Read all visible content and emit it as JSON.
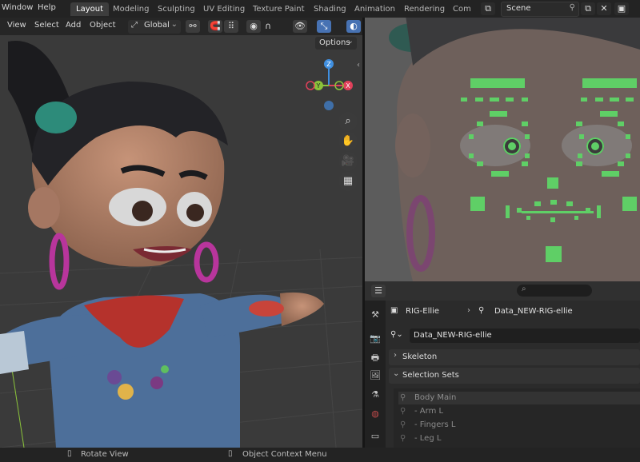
{
  "menubar": {
    "items": [
      "Window",
      "Help"
    ],
    "workspaces": [
      "Layout",
      "Modeling",
      "Sculpting",
      "UV Editing",
      "Texture Paint",
      "Shading",
      "Animation",
      "Rendering",
      "Comp"
    ],
    "active_workspace": "Layout",
    "scene_name": "Scene"
  },
  "viewport": {
    "menus": [
      "View",
      "Select",
      "Add",
      "Object"
    ],
    "transform_orientation": "Global",
    "options_label": "Options",
    "gizmo_axes": {
      "x": "X",
      "y": "Y",
      "z": "Z"
    }
  },
  "properties": {
    "breadcrumb_object": "RIG-Ellie",
    "breadcrumb_data": "Data_NEW-RIG-ellie",
    "data_field": "Data_NEW-RIG-ellie",
    "panels": {
      "skeleton": "Skeleton",
      "selection_sets": "Selection Sets"
    },
    "selection_sets": [
      "Body Main",
      "- Arm L",
      "- Fingers L",
      "- Leg L"
    ]
  },
  "statusbar": {
    "rotate": "Rotate View",
    "context_menu": "Object Context Menu"
  },
  "colors": {
    "accent": "#4772b3",
    "bone_widget": "#5fcf66",
    "axis_x": "#e0405a",
    "axis_y": "#8bc43a",
    "axis_z": "#3f8fe0"
  }
}
